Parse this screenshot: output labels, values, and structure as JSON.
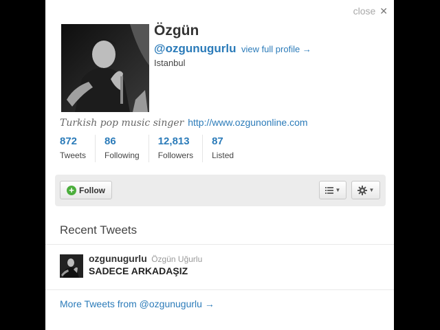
{
  "close_label": "close",
  "close_glyph": "✕",
  "profile": {
    "name": "Özgün",
    "screen_name": "@ozgunugurlu",
    "view_profile": "view full profile →",
    "location": "Istanbul",
    "bio": "Turkish pop music singer",
    "url": "http://www.ozgunonline.com"
  },
  "stats": [
    {
      "value": "872",
      "label": "Tweets"
    },
    {
      "value": "86",
      "label": "Following"
    },
    {
      "value": "12,813",
      "label": "Followers"
    },
    {
      "value": "87",
      "label": "Listed"
    }
  ],
  "actions": {
    "follow_label": "Follow",
    "follow_icon": "plus-circle-icon",
    "list_icon": "list-icon",
    "gear_icon": "gear-icon"
  },
  "recent": {
    "title": "Recent Tweets",
    "tweets": [
      {
        "username": "ozgunugurlu",
        "fullname": "Özgün Uğurlu",
        "text": "SADECE ARKADAŞIZ"
      }
    ],
    "more_label": "More Tweets from @ozgunugurlu →"
  },
  "colors": {
    "link": "#2b7bb9",
    "follow_green": "#4bae3c",
    "backdrop": "#000000"
  }
}
